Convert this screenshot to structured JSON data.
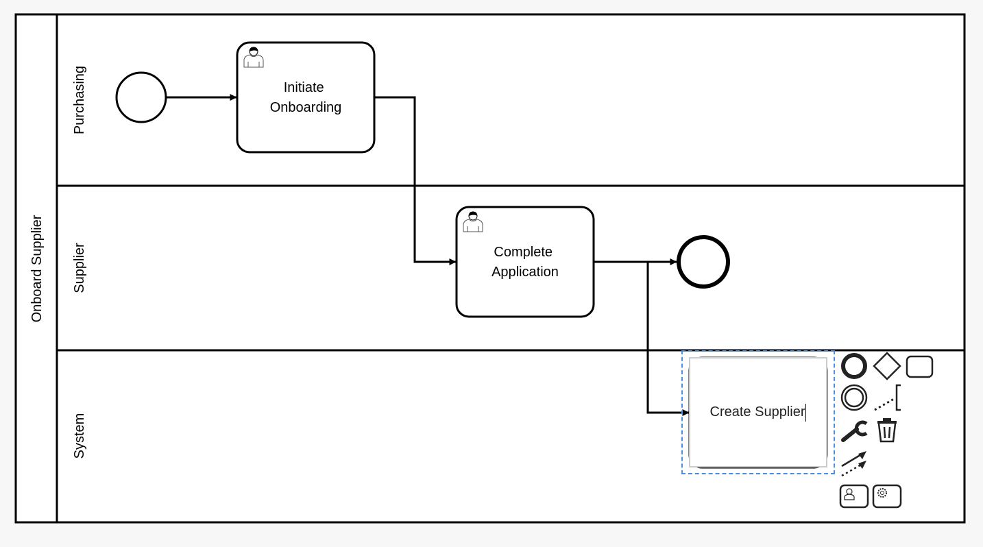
{
  "pool": {
    "name": "Onboard Supplier"
  },
  "lanes": [
    {
      "name": "Purchasing"
    },
    {
      "name": "Supplier"
    },
    {
      "name": "System"
    }
  ],
  "elements": {
    "start_event": {
      "type": "start-event"
    },
    "task_initiate": {
      "type": "user-task",
      "lines": [
        "Initiate",
        "Onboarding"
      ]
    },
    "task_complete": {
      "type": "user-task",
      "lines": [
        "Complete",
        "Application"
      ]
    },
    "end_event": {
      "type": "end-event"
    },
    "task_create": {
      "type": "task",
      "label": "Create Supplier",
      "editing": true
    }
  },
  "context_pad": {
    "entries": [
      {
        "name": "append-end-event",
        "icon": "end-event-icon"
      },
      {
        "name": "append-gateway",
        "icon": "gateway-icon"
      },
      {
        "name": "append-task",
        "icon": "task-icon"
      },
      {
        "name": "append-intermediate-event",
        "icon": "intermediate-event-icon"
      },
      {
        "name": "append-text-annotation",
        "icon": "text-annotation-icon"
      },
      {
        "name": "replace",
        "icon": "wrench-icon"
      },
      {
        "name": "delete",
        "icon": "trash-icon"
      },
      {
        "name": "connect",
        "icon": "connect-icon"
      },
      {
        "name": "append-user-task",
        "icon": "user-task-icon"
      },
      {
        "name": "append-service-task",
        "icon": "service-task-icon"
      }
    ]
  },
  "colors": {
    "selection": "#4a90e2",
    "stroke": "#000000",
    "background": "#f7f7f7"
  }
}
